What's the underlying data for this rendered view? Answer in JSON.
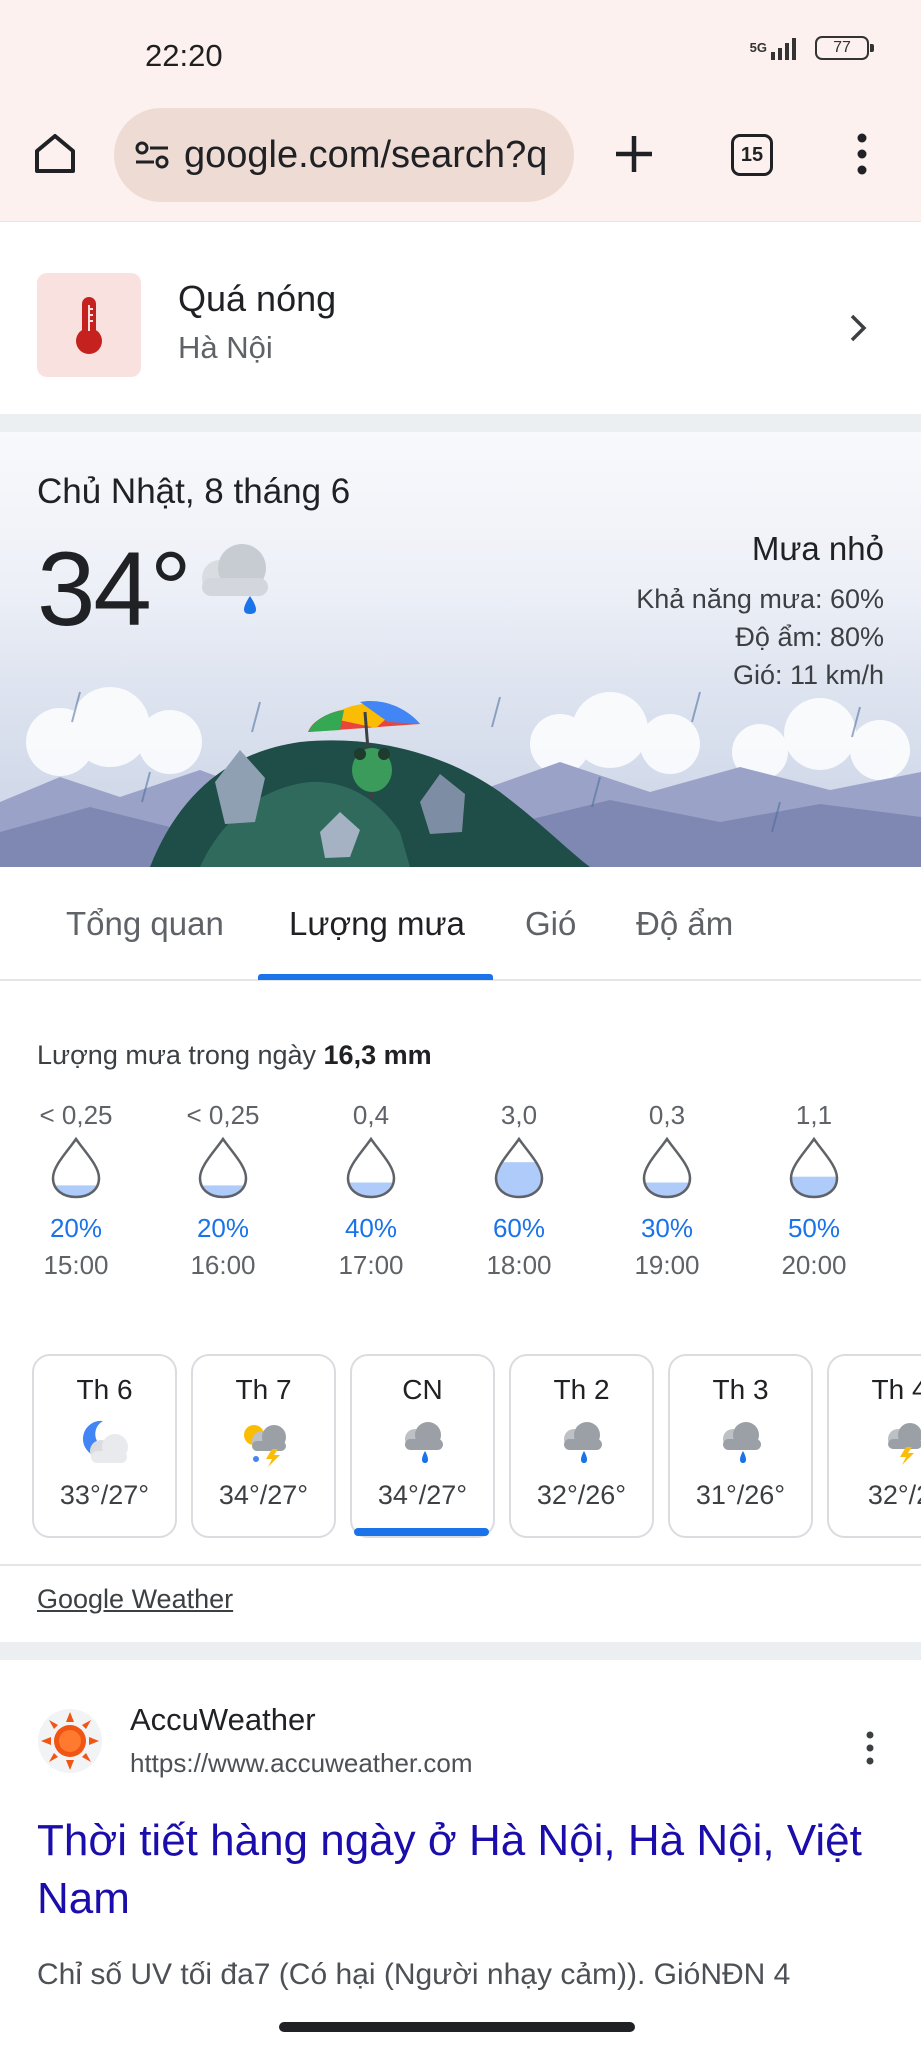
{
  "status": {
    "time": "22:20",
    "network": "5G",
    "battery": "77"
  },
  "browser": {
    "url": "google.com/search?q",
    "tab_count": "15"
  },
  "alert": {
    "title": "Quá nóng",
    "location": "Hà Nội"
  },
  "weather": {
    "date": "Chủ Nhật, 8 tháng 6",
    "temperature": "34°",
    "condition": "Mưa nhỏ",
    "rain_chance": "Khả năng mưa: 60%",
    "humidity": "Độ ẩm: 80%",
    "wind": "Gió: 11 km/h"
  },
  "tabs": [
    {
      "label": "Tổng quan",
      "active": false
    },
    {
      "label": "Lượng mưa",
      "active": true
    },
    {
      "label": "Gió",
      "active": false
    },
    {
      "label": "Độ ẩm",
      "active": false
    }
  ],
  "precipitation": {
    "title_prefix": "Lượng mưa trong ngày",
    "total": "16,3 mm",
    "hours": [
      {
        "amount": "< 0,25",
        "percent": "20%",
        "time": "15:00",
        "fill": 0.2
      },
      {
        "amount": "< 0,25",
        "percent": "20%",
        "time": "16:00",
        "fill": 0.2
      },
      {
        "amount": "0,4",
        "percent": "40%",
        "time": "17:00",
        "fill": 0.25
      },
      {
        "amount": "3,0",
        "percent": "60%",
        "time": "18:00",
        "fill": 0.6
      },
      {
        "amount": "0,3",
        "percent": "30%",
        "time": "19:00",
        "fill": 0.25
      },
      {
        "amount": "1,1",
        "percent": "50%",
        "time": "20:00",
        "fill": 0.35
      }
    ]
  },
  "daily": [
    {
      "day": "Th 6",
      "temps": "33°/27°",
      "icon": "partly-cloudy-night-icon"
    },
    {
      "day": "Th 7",
      "temps": "34°/27°",
      "icon": "thunderstorm-icon"
    },
    {
      "day": "CN",
      "temps": "34°/27°",
      "icon": "light-rain-icon",
      "selected": true
    },
    {
      "day": "Th 2",
      "temps": "32°/26°",
      "icon": "light-rain-icon"
    },
    {
      "day": "Th 3",
      "temps": "31°/26°",
      "icon": "light-rain-icon"
    },
    {
      "day": "Th 4",
      "temps": "32°/2",
      "icon": "thunderstorm-icon"
    }
  ],
  "source_link": "Google Weather",
  "result": {
    "site": "AccuWeather",
    "url": "https://www.accuweather.com",
    "title": "Thời tiết hàng ngày ở Hà Nội, Hà Nội, Việt Nam",
    "snippet": "Chỉ số UV tối đa7 (Có hại (Người nhạy cảm)). GióNĐN 4"
  },
  "colors": {
    "accent": "#1a73e8",
    "link": "#1a0dab",
    "toolbar": "#fcf1ee",
    "alert_red": "#c5221f"
  }
}
